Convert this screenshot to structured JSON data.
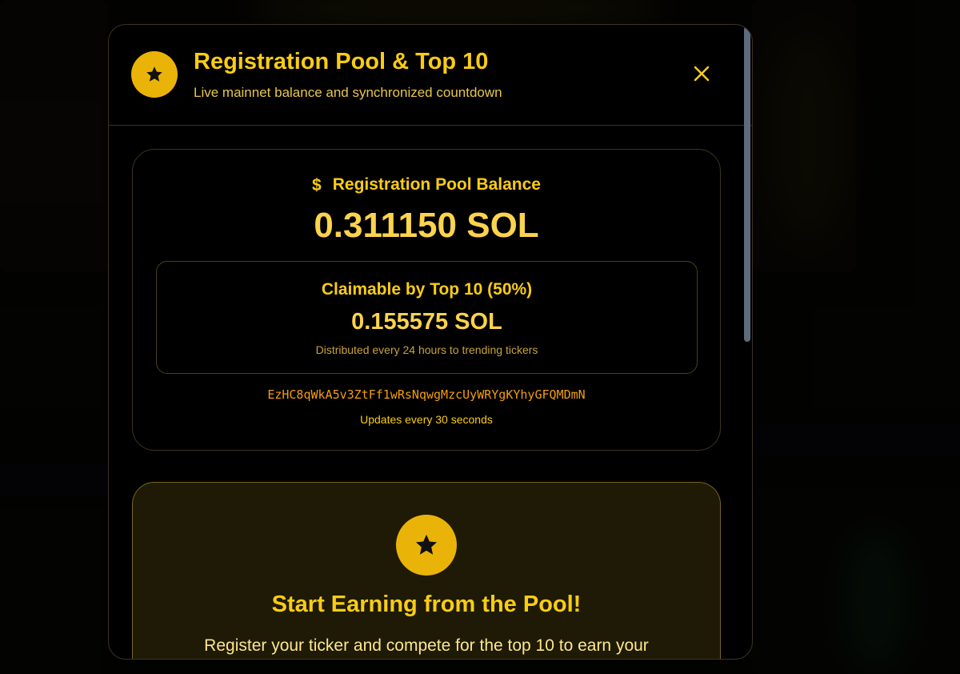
{
  "modal": {
    "title": "Registration Pool & Top 10",
    "subtitle": "Live mainnet balance and synchronized countdown",
    "close_label": "✕",
    "header_icon": "star-icon"
  },
  "balance": {
    "icon": "dollar-icon",
    "dollar_glyph": "$",
    "label": "Registration Pool Balance",
    "value": "0.311150 SOL"
  },
  "claimable": {
    "title": "Claimable by Top 10 (50%)",
    "value": "0.155575 SOL",
    "note": "Distributed every 24 hours to trending tickers"
  },
  "wallet": {
    "address": "EzHC8qWkA5v3ZtFf1wRsNqwgMzcUyWRYgKYhyGFQMDmN",
    "update_note": "Updates every 30 seconds"
  },
  "earn": {
    "icon": "star-icon",
    "title": "Start Earning from the Pool!",
    "text": "Register your ticker and compete for the top 10 to earn your"
  },
  "colors": {
    "accent": "#facc15",
    "badge": "#eab308",
    "modal_bg": "#000000",
    "earn_card_bg": "#1e1a05"
  }
}
